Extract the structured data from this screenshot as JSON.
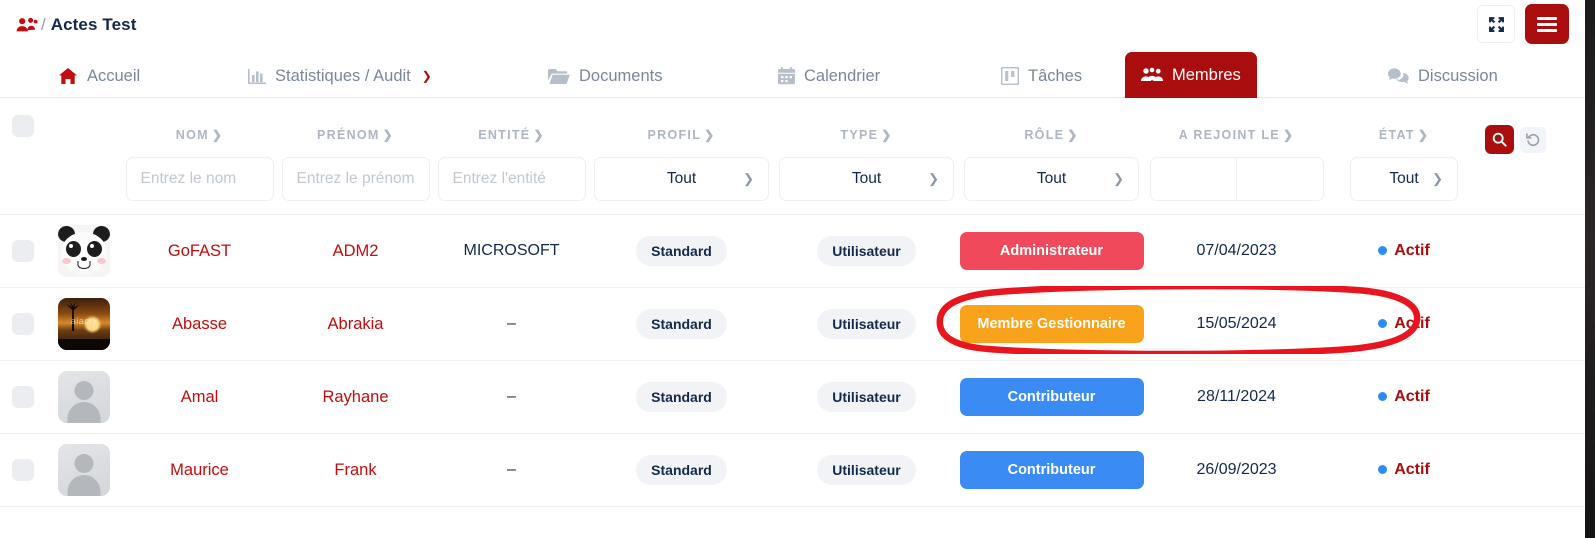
{
  "header": {
    "breadcrumb_icon": "users-icon",
    "breadcrumb_separator": "/",
    "title": "Actes Test",
    "fullscreen_icon": "expand-arrows-icon",
    "menu_icon": "hamburger-menu-icon"
  },
  "nav": {
    "tabs": [
      {
        "label": "Accueil",
        "icon": "home-icon",
        "active": false
      },
      {
        "label": "Statistiques / Audit",
        "icon": "bar-chart-icon",
        "active": false,
        "caret": true
      },
      {
        "label": "Documents",
        "icon": "folder-icon",
        "active": false
      },
      {
        "label": "Calendrier",
        "icon": "calendar-icon",
        "active": false
      },
      {
        "label": "Tâches",
        "icon": "tasks-board-icon",
        "active": false
      },
      {
        "label": "Membres",
        "icon": "members-icon",
        "active": true
      },
      {
        "label": "Discussion",
        "icon": "chat-bubbles-icon",
        "active": false
      }
    ]
  },
  "table": {
    "columns": [
      {
        "key": "nom",
        "label": "NOM"
      },
      {
        "key": "prenom",
        "label": "PRÉNOM"
      },
      {
        "key": "entite",
        "label": "ENTITÉ"
      },
      {
        "key": "profil",
        "label": "PROFIL"
      },
      {
        "key": "type",
        "label": "TYPE"
      },
      {
        "key": "role",
        "label": "RÔLE"
      },
      {
        "key": "rejoint",
        "label": "A REJOINT LE"
      },
      {
        "key": "etat",
        "label": "ÉTAT"
      }
    ],
    "filters": {
      "nom_placeholder": "Entrez le nom",
      "nom_value": "",
      "prenom_placeholder": "Entrez le prénom",
      "prenom_value": "",
      "entite_placeholder": "Entrez l'entité",
      "entite_value": "",
      "profil_value": "Tout",
      "type_value": "Tout",
      "role_value": "Tout",
      "date_from_value": "",
      "date_to_value": "",
      "etat_value": "Tout",
      "search_icon": "magnifier-icon",
      "reset_icon": "undo-arrow-icon"
    },
    "rows": [
      {
        "avatar": "panda-avatar",
        "nom": "GoFAST",
        "prenom": "ADM2",
        "entite": "MICROSOFT",
        "profil": "Standard",
        "type": "Utilisateur",
        "role": "Administrateur",
        "role_style": "admin",
        "rejoint": "07/04/2023",
        "etat": "Actif"
      },
      {
        "avatar": "sunset-photo-avatar",
        "nom": "Abasse",
        "prenom": "Abrakia",
        "entite": "–",
        "profil": "Standard",
        "type": "Utilisateur",
        "role": "Membre Gestionnaire",
        "role_style": "gestionnaire",
        "rejoint": "15/05/2024",
        "etat": "Actif"
      },
      {
        "avatar": "default-person-avatar",
        "nom": "Amal",
        "prenom": "Rayhane",
        "entite": "–",
        "profil": "Standard",
        "type": "Utilisateur",
        "role": "Contributeur",
        "role_style": "contributeur",
        "rejoint": "28/11/2024",
        "etat": "Actif"
      },
      {
        "avatar": "default-person-avatar",
        "nom": "Maurice",
        "prenom": "Frank",
        "entite": "–",
        "profil": "Standard",
        "type": "Utilisateur",
        "role": "Contributeur",
        "role_style": "contributeur",
        "rejoint": "26/09/2023",
        "etat": "Actif"
      }
    ]
  },
  "annotation": {
    "shape": "hand-drawn-red-ellipse",
    "color": "#e8151e",
    "target": "Membre Gestionnaire role row"
  },
  "colors": {
    "brand_red": "#a90d0d",
    "icon_red": "#c10d0d",
    "navy": "#13294b",
    "admin_badge": "#f0495c",
    "gestionnaire_badge": "#f9a21b",
    "contributeur_badge": "#3b8bf5",
    "state_dot": "#2b8df5",
    "muted": "#aeb6c2"
  }
}
